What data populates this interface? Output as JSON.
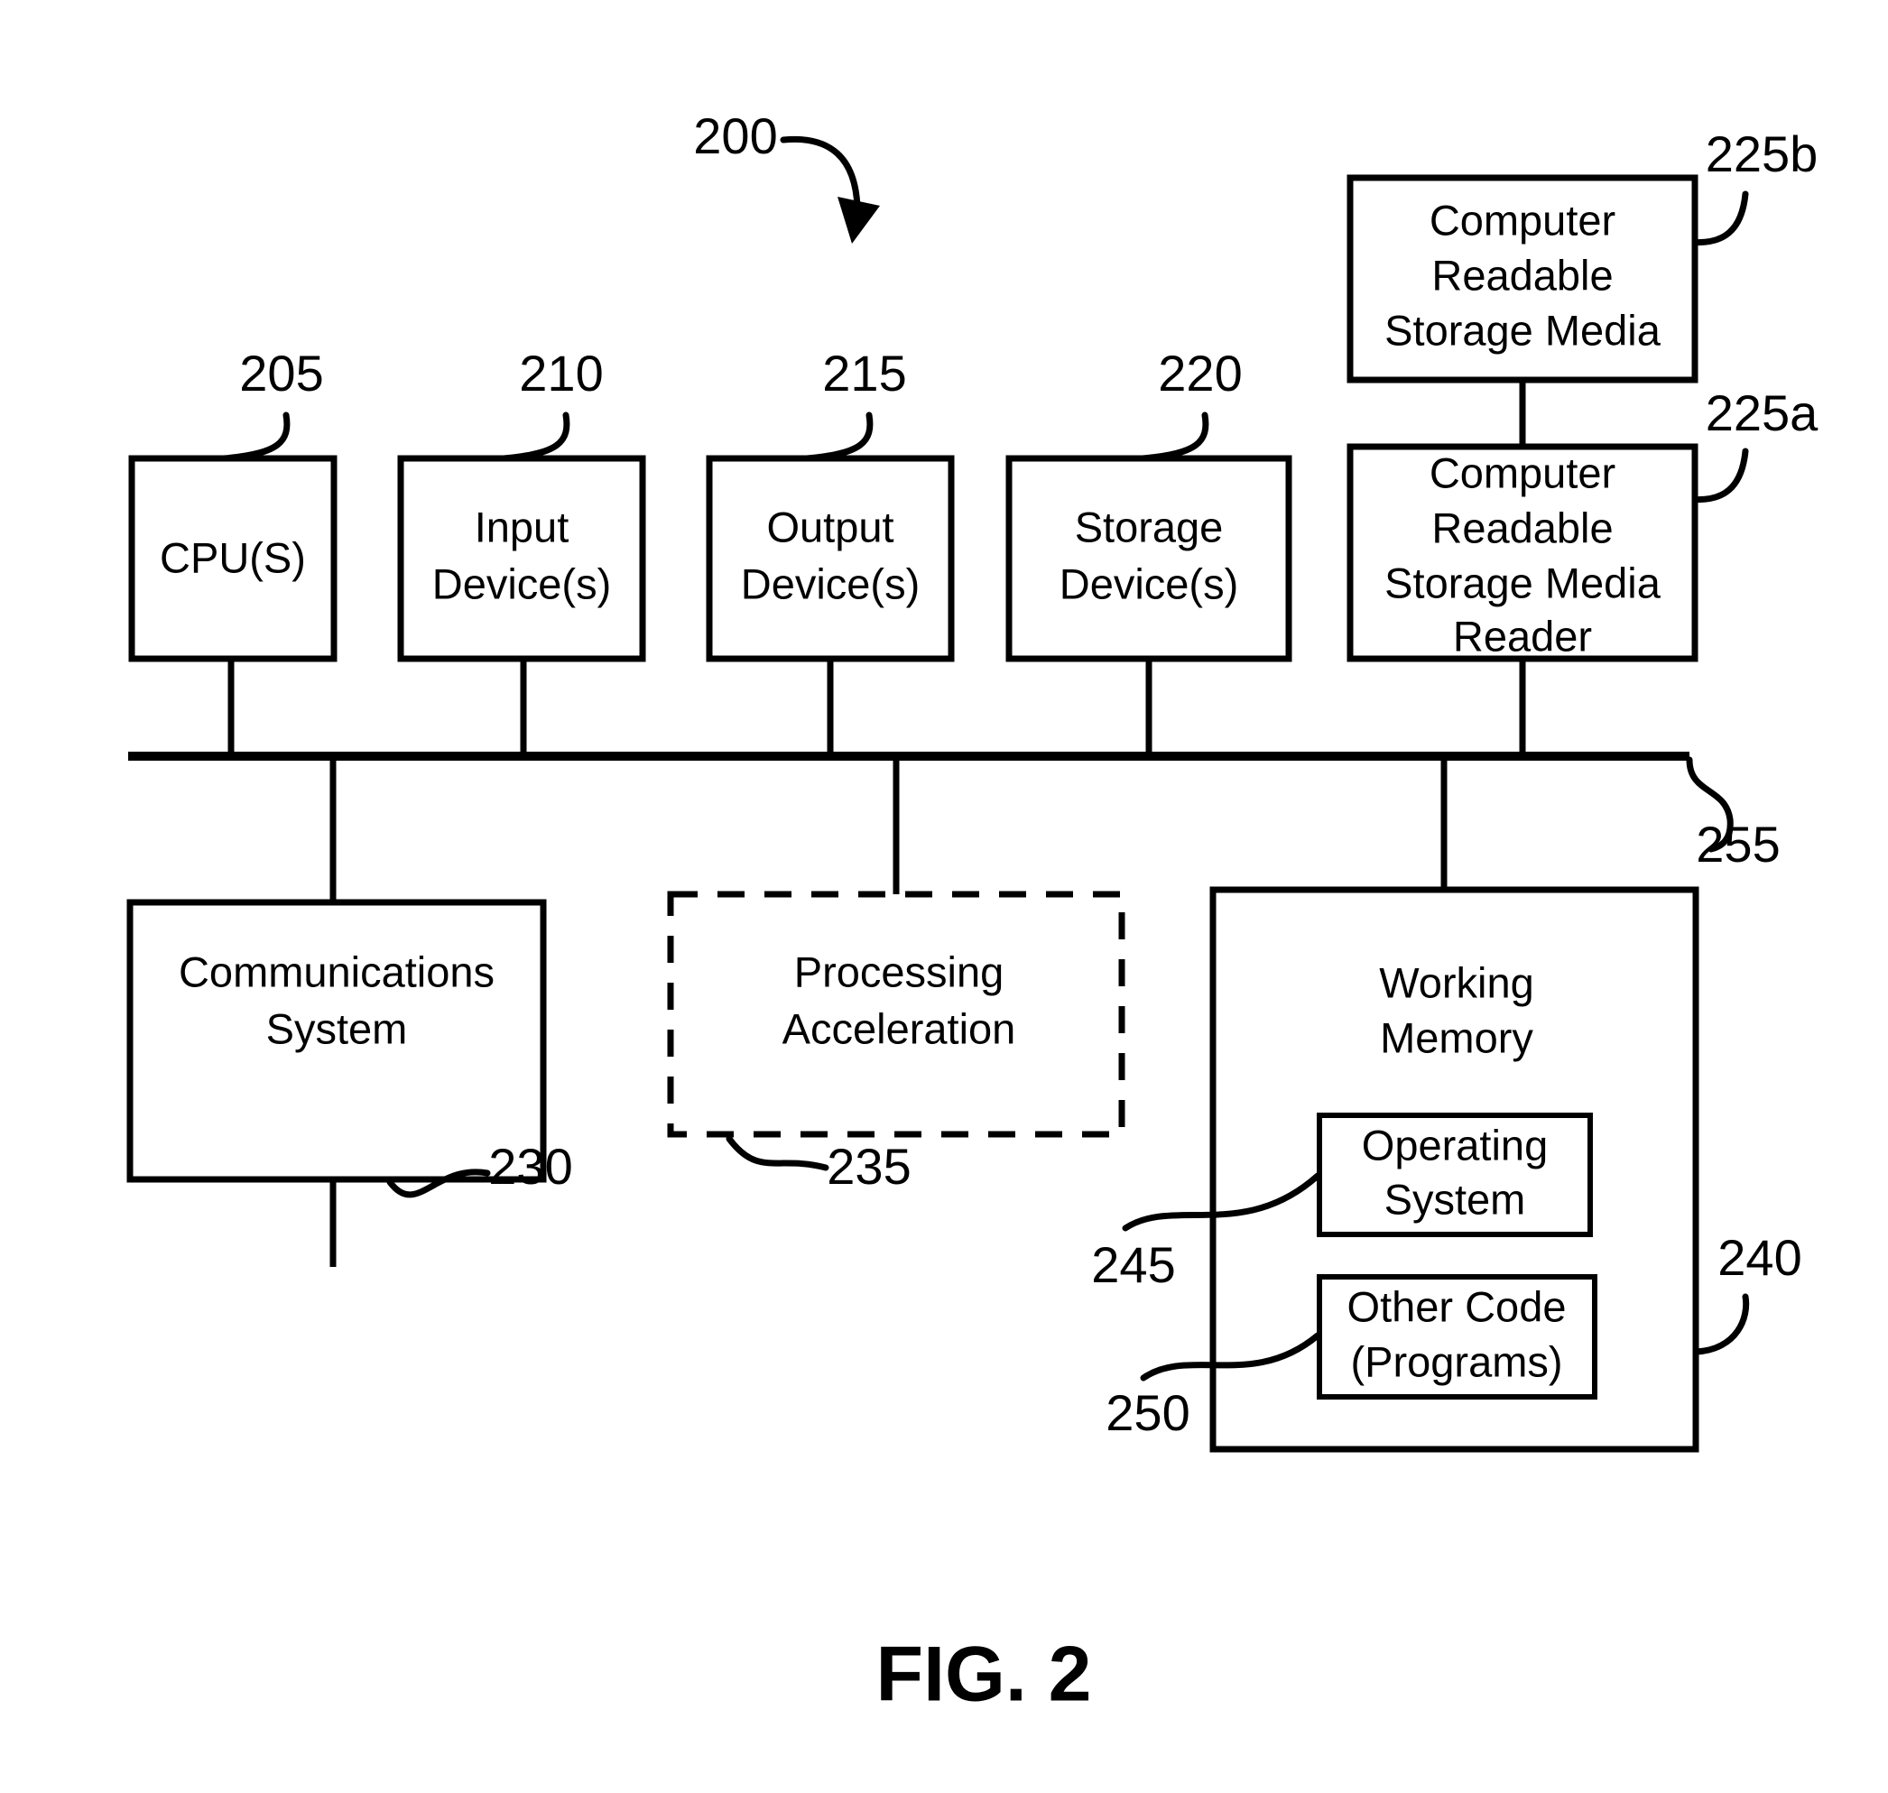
{
  "figure": {
    "caption": "FIG. 2",
    "system_ref": "200",
    "title_text": "FIG. 2"
  },
  "blocks": [
    {
      "id": "cpu",
      "ref": "205",
      "lines": [
        "CPU(S)"
      ],
      "style": "solid"
    },
    {
      "id": "input-devices",
      "ref": "210",
      "lines": [
        "Input",
        "Device(s)"
      ],
      "style": "solid"
    },
    {
      "id": "output-devices",
      "ref": "215",
      "lines": [
        "Output",
        "Device(s)"
      ],
      "style": "solid"
    },
    {
      "id": "storage-devices",
      "ref": "220",
      "lines": [
        "Storage",
        "Device(s)"
      ],
      "style": "solid"
    },
    {
      "id": "computer-readable-storage-media",
      "ref": "225b",
      "lines": [
        "Computer",
        "Readable",
        "Storage Media"
      ],
      "style": "solid"
    },
    {
      "id": "computer-readable-storage-media-reader",
      "ref": "225a",
      "lines": [
        "Computer",
        "Readable",
        "Storage Media",
        "Reader"
      ],
      "style": "solid"
    },
    {
      "id": "communications-system",
      "ref": "230",
      "lines": [
        "Communications",
        "System"
      ],
      "style": "solid"
    },
    {
      "id": "processing-acceleration",
      "ref": "235",
      "lines": [
        "Processing",
        "Acceleration"
      ],
      "style": "dashed"
    },
    {
      "id": "working-memory",
      "ref": "240",
      "lines": [
        "Working",
        "Memory"
      ],
      "style": "solid"
    },
    {
      "id": "operating-system",
      "ref": "245",
      "lines": [
        "Operating",
        "System"
      ],
      "style": "solid"
    },
    {
      "id": "other-code-programs",
      "ref": "250",
      "lines": [
        "Other Code",
        "(Programs)"
      ],
      "style": "solid"
    }
  ],
  "bus": {
    "ref": "255",
    "name": "system-bus"
  },
  "labels": {
    "cpu_line1": "CPU(S)",
    "input_line1": "Input",
    "input_line2": "Device(s)",
    "output_line1": "Output",
    "output_line2": "Device(s)",
    "storage_line1": "Storage",
    "storage_line2": "Device(s)",
    "media_line1": "Computer",
    "media_line2": "Readable",
    "media_line3": "Storage Media",
    "reader_line1": "Computer",
    "reader_line2": "Readable",
    "reader_line3": "Storage Media",
    "reader_line4": "Reader",
    "comms_line1": "Communications",
    "comms_line2": "System",
    "accel_line1": "Processing",
    "accel_line2": "Acceleration",
    "memory_line1": "Working",
    "memory_line2": "Memory",
    "os_line1": "Operating",
    "os_line2": "System",
    "code_line1": "Other Code",
    "code_line2": "(Programs)"
  },
  "refs": {
    "r200": "200",
    "r205": "205",
    "r210": "210",
    "r215": "215",
    "r220": "220",
    "r225a": "225a",
    "r225b": "225b",
    "r230": "230",
    "r235": "235",
    "r240": "240",
    "r245": "245",
    "r250": "250",
    "r255": "255"
  },
  "colors": {
    "ink": "#000000",
    "paper": "#ffffff"
  }
}
